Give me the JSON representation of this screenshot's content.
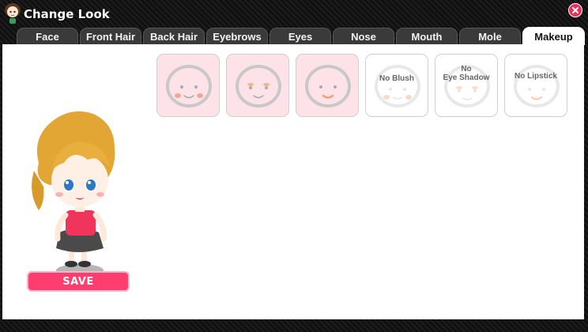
{
  "window": {
    "title": "Change Look"
  },
  "tabs": [
    {
      "label": "Face"
    },
    {
      "label": "Front Hair"
    },
    {
      "label": "Back Hair"
    },
    {
      "label": "Eyebrows"
    },
    {
      "label": "Eyes"
    },
    {
      "label": "Nose"
    },
    {
      "label": "Mouth"
    },
    {
      "label": "Mole"
    },
    {
      "label": "Makeup"
    }
  ],
  "active_tab": "Makeup",
  "makeup_options": [
    {
      "label": "",
      "style": "blush"
    },
    {
      "label": "",
      "style": "eye-shadow"
    },
    {
      "label": "",
      "style": "lipstick"
    },
    {
      "label": "No Blush",
      "style": "none"
    },
    {
      "label_line1": "No",
      "label_line2": "Eye Shadow",
      "style": "none"
    },
    {
      "label": "No Lipstick",
      "style": "none"
    }
  ],
  "save_button": {
    "label": "SAVE"
  },
  "colors": {
    "tab_active": "#ffffff",
    "tab_inactive": "#3a3a3a",
    "save_button": "#ff3d6e",
    "close_button": "#e8305a",
    "selected_tile": "#fde3e8",
    "blush": "#f7a29b",
    "eye_shadow": "#f7b487",
    "lipstick": "#f4a07a"
  }
}
